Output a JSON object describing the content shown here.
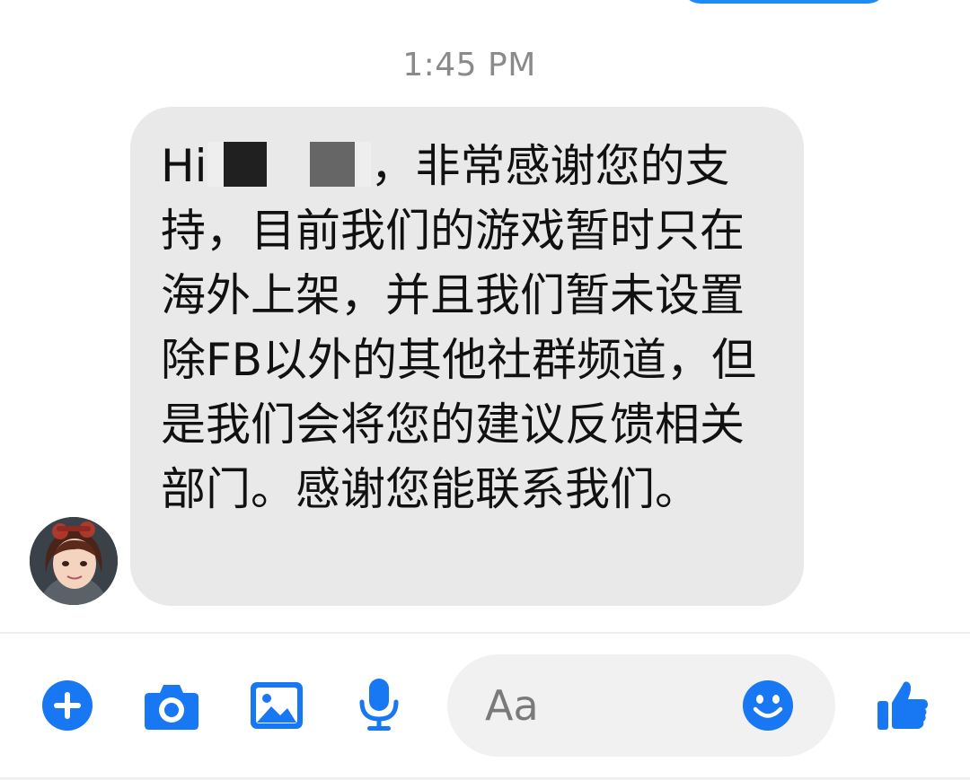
{
  "conversation": {
    "timestamp": "1:45 PM",
    "message": {
      "greeting_prefix": "Hi",
      "greeting_suffix": "，非常感谢您的",
      "body": "支持，目前我们的游戏暂时只在海外上架，并且我们暂未设置除FB以外的其他社群频道，但是我们会将您的建议反馈相关部门。感谢您能联系我们。"
    }
  },
  "composer": {
    "placeholder": "Aa"
  },
  "toolbar_icons": [
    "plus-circle-icon",
    "camera-icon",
    "image-icon",
    "microphone-icon",
    "smiley-icon",
    "thumbs-up-icon"
  ],
  "colors": {
    "accent": "#1877f2",
    "bubble_bg": "#e9e9e9",
    "composer_bg": "#f1f1f1",
    "timestamp": "#8a8a8a"
  }
}
